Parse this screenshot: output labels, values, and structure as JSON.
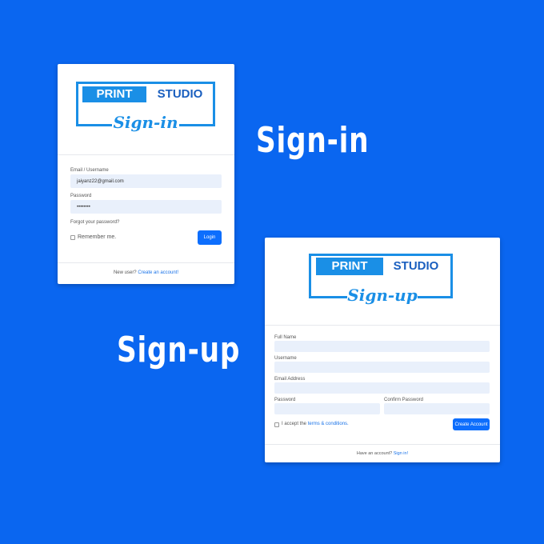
{
  "labels": {
    "signin": "Sign-in",
    "signup": "Sign-up"
  },
  "brand": {
    "print": "PRINT",
    "studio": "STUDIO",
    "signin_script": "Sign-in",
    "signup_script": "Sign-up"
  },
  "signin": {
    "email_label": "Email / Username",
    "email_value": "jaiyanz22@gmail.com",
    "password_label": "Password",
    "password_value": "••••••••",
    "forgot_link": "Forgot your password?",
    "remember_label": "Remember me.",
    "login_button": "Login",
    "footer_text": "New user?",
    "footer_link": "Create an account!"
  },
  "signup": {
    "fullname_label": "Full Name",
    "username_label": "Username",
    "email_label": "Email Address",
    "password_label": "Password",
    "confirm_label": "Confirm Password",
    "accept_text": "I accept the",
    "terms_link": "terms & conditions.",
    "create_button": "Create Account",
    "footer_text": "Have an account?",
    "footer_link": "Sign in!"
  },
  "colors": {
    "background": "#0a66f0",
    "brand_blue": "#1a8fe6",
    "button": "#0d6efd"
  }
}
